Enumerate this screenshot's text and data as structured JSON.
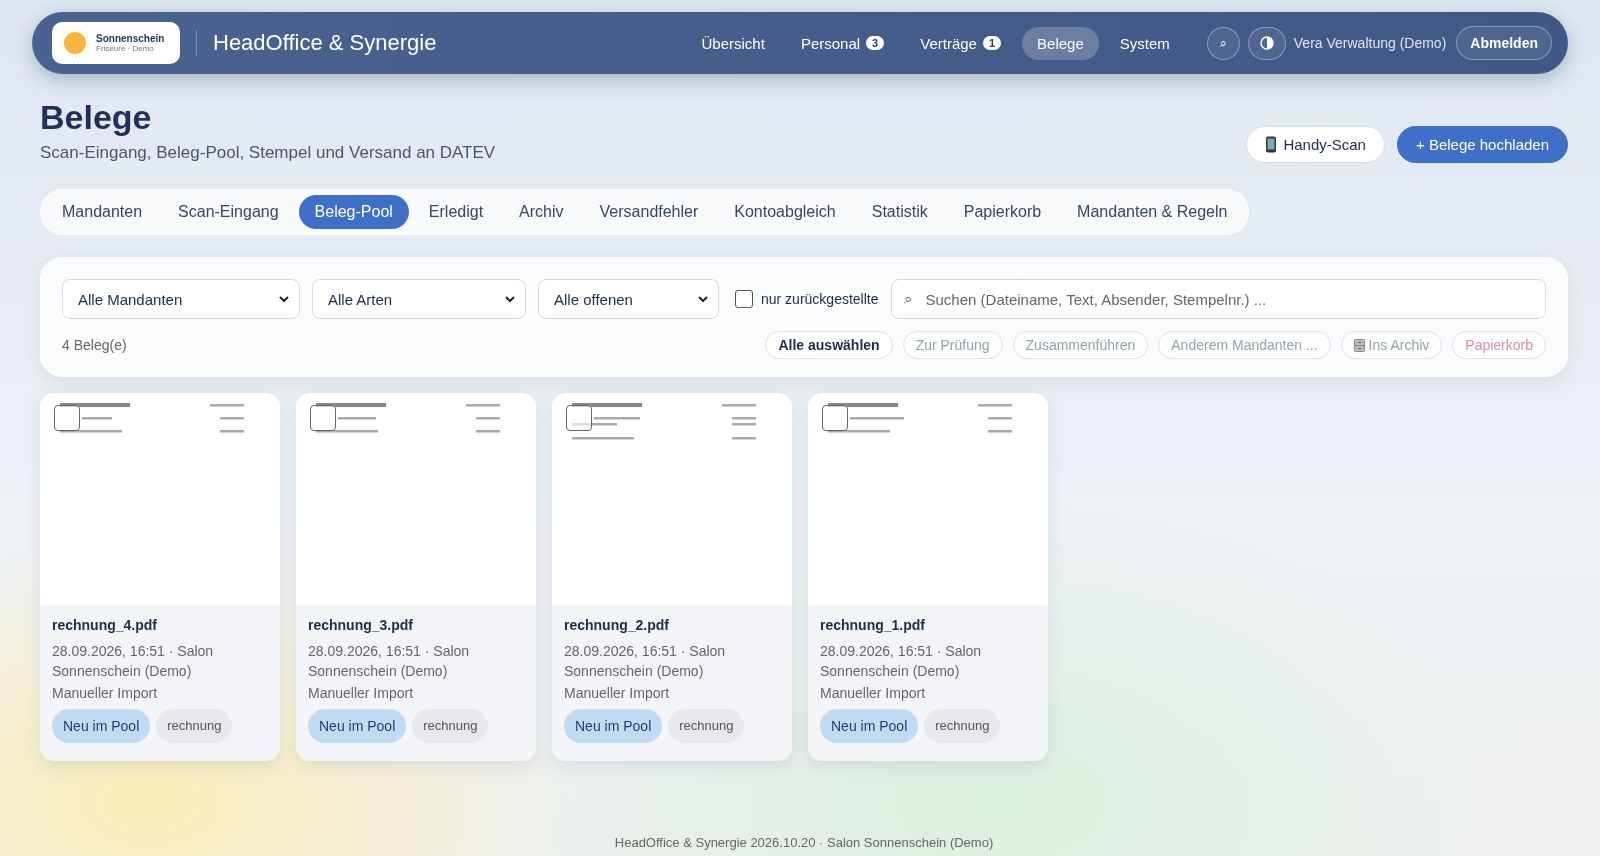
{
  "header": {
    "logo": {
      "name": "Sonnenschein",
      "tagline": "Friseure · Demo"
    },
    "app_title": "HeadOffice & Synergie",
    "nav": [
      {
        "label": "Übersicht",
        "selected": false
      },
      {
        "label": "Personal",
        "badge": "3",
        "selected": false
      },
      {
        "label": "Verträge",
        "badge": "1",
        "selected": false
      },
      {
        "label": "Belege",
        "selected": true
      },
      {
        "label": "System",
        "selected": false
      }
    ],
    "search_icon": "⌕",
    "user": "Vera Verwaltung (Demo)",
    "logout": "Abmelden"
  },
  "page": {
    "title": "Belege",
    "subtitle": "Scan-Eingang, Beleg-Pool, Stempel und Versand an DATEV",
    "actions": [
      {
        "label": "Handy-Scan",
        "kind": "secondary"
      },
      {
        "label": "+ Belege hochladen",
        "kind": "primary"
      }
    ]
  },
  "tabs": [
    {
      "label": "Mandanten",
      "selected": false
    },
    {
      "label": "Scan-Eingang",
      "selected": false
    },
    {
      "label": "Beleg-Pool",
      "selected": true
    },
    {
      "label": "Erledigt",
      "selected": false
    },
    {
      "label": "Archiv",
      "selected": false
    },
    {
      "label": "Versandfehler",
      "selected": false
    },
    {
      "label": "Kontoabgleich",
      "selected": false
    },
    {
      "label": "Statistik",
      "selected": false
    },
    {
      "label": "Papierkorb",
      "selected": false
    },
    {
      "label": "Mandanten & Regeln",
      "selected": false
    }
  ],
  "filters": {
    "selects": [
      "Alle Mandanten",
      "Alle Arten",
      "Alle offenen"
    ],
    "only_deferred": {
      "label": "nur zurückgestellte",
      "checked": false
    },
    "search": {
      "icon": "⌕",
      "placeholder": "Suchen (Dateiname, Text, Absender, Stempelnr.) ..."
    },
    "count": "4 Beleg(e)",
    "bulk_actions": [
      {
        "label": "Alle auswählen",
        "kind": "normal",
        "disabled": false
      },
      {
        "label": "Zur Prüfung",
        "kind": "normal",
        "disabled": true
      },
      {
        "label": "Zusammenführen",
        "kind": "normal",
        "disabled": true
      },
      {
        "label": "Anderem Mandanten ...",
        "kind": "normal",
        "disabled": true
      },
      {
        "label": "Ins Archiv",
        "kind": "archive",
        "disabled": true
      },
      {
        "label": "Papierkorb",
        "kind": "danger",
        "disabled": true
      }
    ]
  },
  "documents": [
    {
      "file": "rechnung_4.pdf",
      "meta": "28.09.2026, 16:51 · Salon Sonnenschein (Demo)",
      "source": "Manueller Import",
      "selected": false,
      "tags": [
        {
          "label": "Neu im Pool",
          "kind": "status"
        },
        {
          "label": "rechnung",
          "kind": "type"
        }
      ]
    },
    {
      "file": "rechnung_3.pdf",
      "meta": "28.09.2026, 16:51 · Salon Sonnenschein (Demo)",
      "source": "Manueller Import",
      "selected": false,
      "tags": [
        {
          "label": "Neu im Pool",
          "kind": "status"
        },
        {
          "label": "rechnung",
          "kind": "type"
        }
      ]
    },
    {
      "file": "rechnung_2.pdf",
      "meta": "28.09.2026, 16:51 · Salon Sonnenschein (Demo)",
      "source": "Manueller Import",
      "selected": false,
      "tags": [
        {
          "label": "Neu im Pool",
          "kind": "status"
        },
        {
          "label": "rechnung",
          "kind": "type"
        }
      ]
    },
    {
      "file": "rechnung_1.pdf",
      "meta": "28.09.2026, 16:51 · Salon Sonnenschein (Demo)",
      "source": "Manueller Import",
      "selected": false,
      "tags": [
        {
          "label": "Neu im Pool",
          "kind": "status"
        },
        {
          "label": "rechnung",
          "kind": "type"
        }
      ]
    }
  ],
  "footer": "HeadOffice & Synergie 2026.10.20 · Salon Sonnenschein (Demo)"
}
